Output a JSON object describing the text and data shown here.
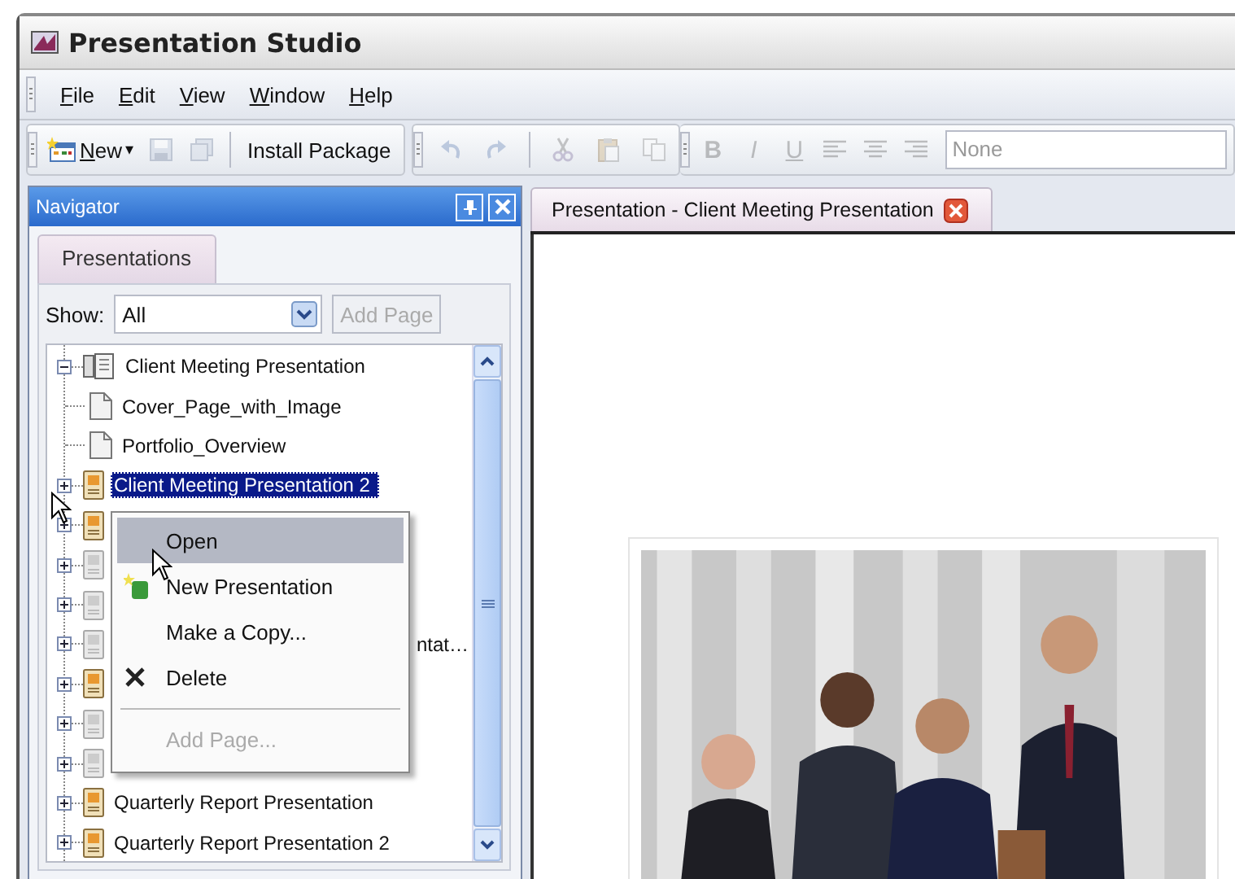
{
  "window": {
    "title": "Presentation Studio"
  },
  "menu": [
    {
      "label": "File"
    },
    {
      "label": "Edit"
    },
    {
      "label": "View"
    },
    {
      "label": "Window"
    },
    {
      "label": "Help"
    }
  ],
  "toolbars": [
    {
      "items": [
        {
          "kind": "new",
          "label": "New",
          "caret": "▾",
          "disabled": false
        },
        {
          "kind": "save",
          "disabled": true
        },
        {
          "kind": "saveall",
          "disabled": true
        },
        {
          "kind": "separator"
        },
        {
          "kind": "text",
          "label": "Install Package",
          "disabled": false
        }
      ]
    },
    {
      "items": [
        {
          "kind": "undo",
          "disabled": true
        },
        {
          "kind": "redo",
          "disabled": true
        },
        {
          "kind": "separator"
        },
        {
          "kind": "cut",
          "disabled": true
        },
        {
          "kind": "paste",
          "disabled": true
        },
        {
          "kind": "copy",
          "disabled": true
        }
      ]
    },
    {
      "items": [
        {
          "kind": "bold",
          "label": "B",
          "disabled": true
        },
        {
          "kind": "italic",
          "label": "I",
          "disabled": true
        },
        {
          "kind": "underline",
          "label": "U",
          "disabled": true
        },
        {
          "kind": "align_left",
          "disabled": true
        },
        {
          "kind": "align_center",
          "disabled": true
        },
        {
          "kind": "align_right",
          "disabled": true
        },
        {
          "kind": "field",
          "value": "None",
          "disabled": true
        }
      ]
    }
  ],
  "navigator": {
    "title": "Navigator",
    "tabs": [
      {
        "label": "Presentations",
        "selected": true
      }
    ],
    "show_label": "Show:",
    "show_value": "All",
    "add_page": {
      "label": "Add Page",
      "disabled": true
    },
    "tree": [
      {
        "label": "Client Meeting Presentation",
        "kind": "book",
        "expanded": true,
        "selected": false,
        "children": [
          {
            "label": "Cover_Page_with_Image",
            "kind": "page",
            "selected": false
          },
          {
            "label": "Portfolio_Overview",
            "kind": "page",
            "selected": false
          }
        ]
      },
      {
        "label": "Client Meeting Presentation 2",
        "kind": "presentation",
        "expanded": false,
        "selected": true
      },
      {
        "kind": "presentation",
        "expanded": false
      },
      {
        "kind": "faded",
        "expanded": false
      },
      {
        "kind": "faded",
        "expanded": false
      },
      {
        "label": "ntat…",
        "kind": "faded",
        "expanded": false,
        "selected": false,
        "obscured": true
      },
      {
        "kind": "presentation",
        "expanded": false
      },
      {
        "kind": "faded",
        "expanded": false
      },
      {
        "kind": "faded",
        "expanded": false
      },
      {
        "label": "Quarterly Report Presentation",
        "kind": "presentation",
        "expanded": false,
        "selected": false
      },
      {
        "label": "Quarterly Report Presentation 2",
        "kind": "presentation",
        "expanded": false,
        "selected": false
      }
    ]
  },
  "context_menu": [
    {
      "kind": "plain",
      "label": "Open",
      "selected": true,
      "disabled": false
    },
    {
      "kind": "new",
      "label": "New Presentation",
      "selected": false,
      "disabled": false
    },
    {
      "kind": "plain",
      "label": "Make a Copy...",
      "selected": false,
      "disabled": false
    },
    {
      "kind": "delete",
      "label": "Delete",
      "selected": false,
      "disabled": false
    },
    {
      "kind": "separator"
    },
    {
      "kind": "plain",
      "label": "Add Page...",
      "selected": false,
      "disabled": true
    }
  ],
  "document": {
    "tabs": [
      {
        "label": "Presentation - Client Meeting Presentation",
        "selected": true
      }
    ]
  }
}
